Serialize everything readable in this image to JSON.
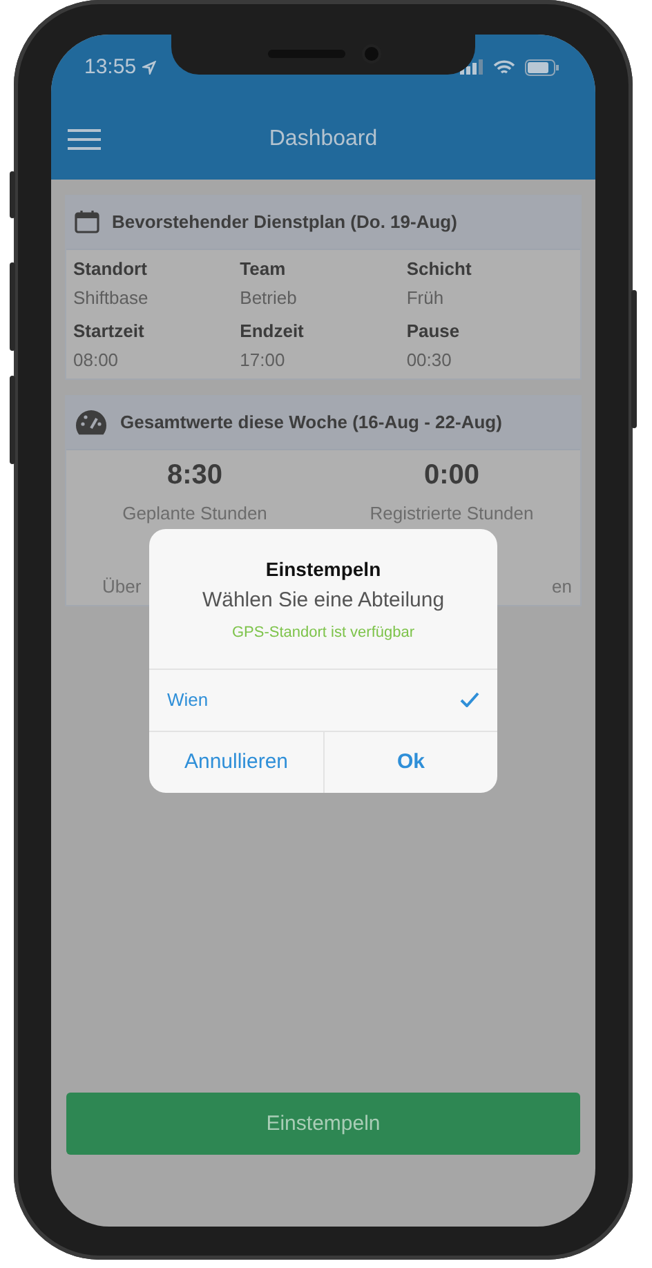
{
  "status_bar": {
    "time": "13:55"
  },
  "nav": {
    "title": "Dashboard"
  },
  "schedule_card": {
    "title": "Bevorstehender Dienstplan (Do. 19-Aug)",
    "fields": [
      {
        "label": "Standort",
        "value": "Shiftbase"
      },
      {
        "label": "Team",
        "value": "Betrieb"
      },
      {
        "label": "Schicht",
        "value": "Früh"
      },
      {
        "label": "Startzeit",
        "value": "08:00"
      },
      {
        "label": "Endzeit",
        "value": "17:00"
      },
      {
        "label": "Pause",
        "value": "00:30"
      }
    ]
  },
  "totals_card": {
    "title": "Gesamtwerte diese Woche (16-Aug - 22-Aug)",
    "stats": [
      {
        "value": "8:30",
        "label": "Geplante Stunden"
      },
      {
        "value": "0:00",
        "label": "Registrierte Stunden"
      }
    ],
    "partial_labels": [
      "Über",
      "en"
    ]
  },
  "dialog": {
    "title": "Einstempeln",
    "message": "Wählen Sie eine Abteilung",
    "gps_status": "GPS-Standort ist verfügbar",
    "options": [
      {
        "label": "Wien",
        "selected": true
      }
    ],
    "buttons": [
      {
        "label": "Annullieren",
        "kind": "cancel"
      },
      {
        "label": "Ok",
        "kind": "confirm"
      }
    ]
  },
  "clock_in_button": {
    "label": "Einstempeln"
  }
}
